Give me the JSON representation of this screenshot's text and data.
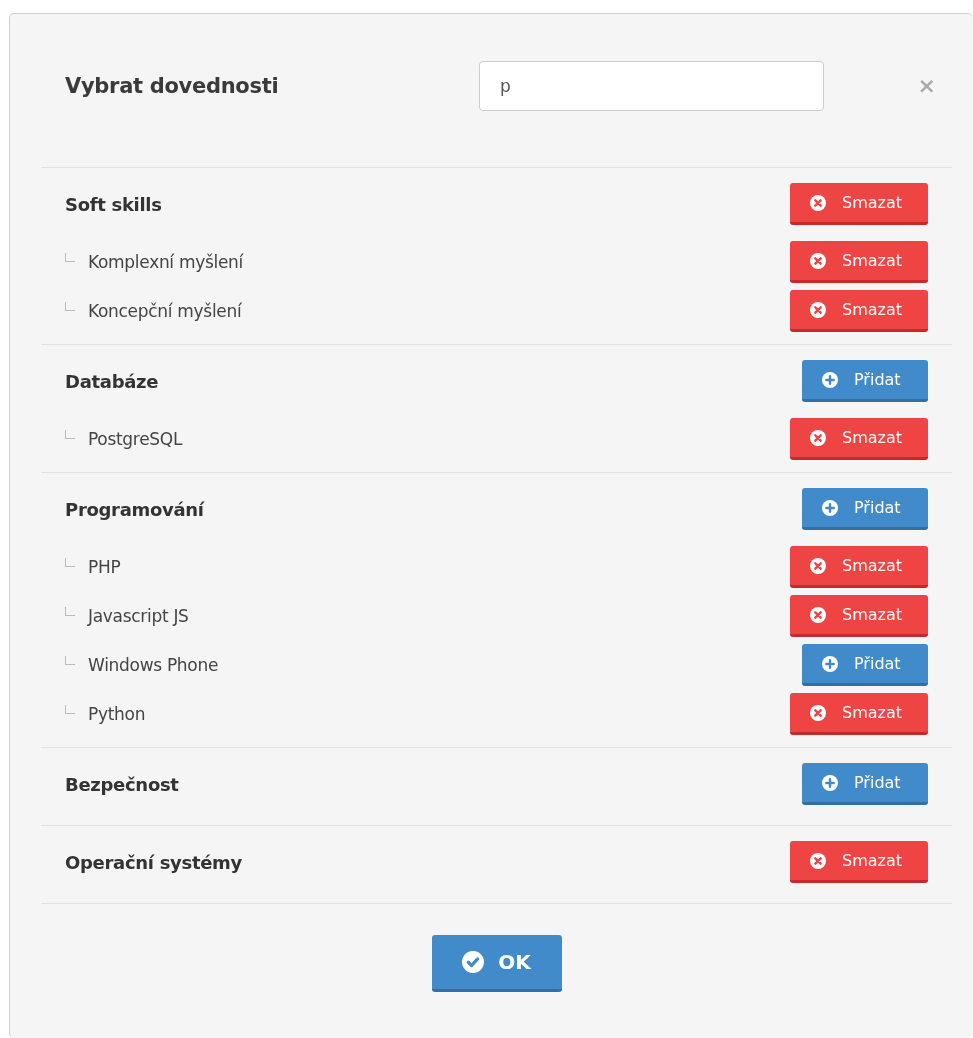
{
  "dialog": {
    "title": "Vybrat dovednosti",
    "search": {
      "value": "p"
    },
    "close": "×"
  },
  "groups": [
    {
      "name": "Soft skills",
      "action": {
        "kind": "remove",
        "label": "Smazat"
      },
      "items": [
        {
          "name": "Komplexní myšlení",
          "action": {
            "kind": "remove",
            "label": "Smazat"
          }
        },
        {
          "name": "Koncepční myšlení",
          "action": {
            "kind": "remove",
            "label": "Smazat"
          }
        }
      ]
    },
    {
      "name": "Databáze",
      "action": {
        "kind": "add",
        "label": "Přidat"
      },
      "items": [
        {
          "name": "PostgreSQL",
          "action": {
            "kind": "remove",
            "label": "Smazat"
          }
        }
      ]
    },
    {
      "name": "Programování",
      "action": {
        "kind": "add",
        "label": "Přidat"
      },
      "items": [
        {
          "name": "PHP",
          "action": {
            "kind": "remove",
            "label": "Smazat"
          }
        },
        {
          "name": "Javascript JS",
          "action": {
            "kind": "remove",
            "label": "Smazat"
          }
        },
        {
          "name": "Windows Phone",
          "action": {
            "kind": "add",
            "label": "Přidat"
          }
        },
        {
          "name": "Python",
          "action": {
            "kind": "remove",
            "label": "Smazat"
          }
        }
      ]
    },
    {
      "name": "Bezpečnost",
      "action": {
        "kind": "add",
        "label": "Přidat"
      }
    },
    {
      "name": "Operační systémy",
      "action": {
        "kind": "remove",
        "label": "Smazat"
      }
    }
  ],
  "ok_button": {
    "label": "OK"
  }
}
